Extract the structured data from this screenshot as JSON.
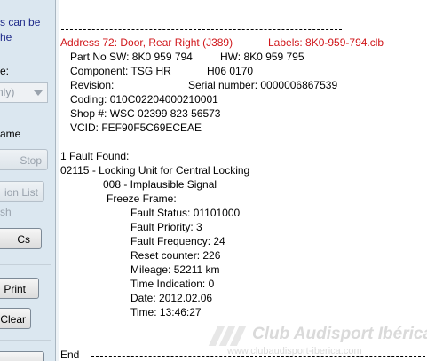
{
  "sidebar": {
    "text_can_be": "s can be",
    "text_the": "he",
    "text_colon": "e:",
    "combo_value": "nly)",
    "label_frame": "ame",
    "stop_button": "Stop",
    "session_list_button": "ion List",
    "label_refresh": "sh",
    "cs_button": "Cs",
    "print_button": "Print",
    "clear_button": "Clear",
    "bottom_button": ""
  },
  "report": {
    "separator": "------------------------------------------------------------------------",
    "address_line": "Address 72: Door, Rear Right (J389)",
    "labels_line": "Labels: 8K0-959-794.clb",
    "part_no": "Part No SW: 8K0 959 794",
    "hw": "HW: 8K0 959 795",
    "component": "Component: TSG HR",
    "component_version": "H06 0170",
    "revision": "Revision:",
    "serial": "Serial number: 0000006867539",
    "coding": "Coding: 010C02204000210001",
    "shop": "Shop #: WSC 02399 823 56573",
    "vcid": "VCID: FEF90F5C69ECEAE",
    "faults_found": "1 Fault Found:",
    "fault_code": "02115 - Locking Unit for Central Locking",
    "fault_detail": "008 - Implausible Signal",
    "freeze_frame": "Freeze Frame:",
    "fault_status": "Fault Status: 01101000",
    "fault_priority": "Fault Priority: 3",
    "fault_frequency": "Fault Frequency: 24",
    "reset_counter": "Reset counter: 226",
    "mileage": "Mileage: 52211 km",
    "time_indication": "Time Indication: 0",
    "date": "Date: 2012.02.06",
    "time": "Time: 13:46:27",
    "end": "End"
  },
  "watermark": {
    "title": "Club Audisport Ibérica",
    "url": "www.clubaudisport-iberica.com"
  },
  "colors": {
    "address_red": "#d0161a",
    "sidebar_bg": "#dbe7f0",
    "sidebar_text_blue": "#1f2a8a"
  }
}
